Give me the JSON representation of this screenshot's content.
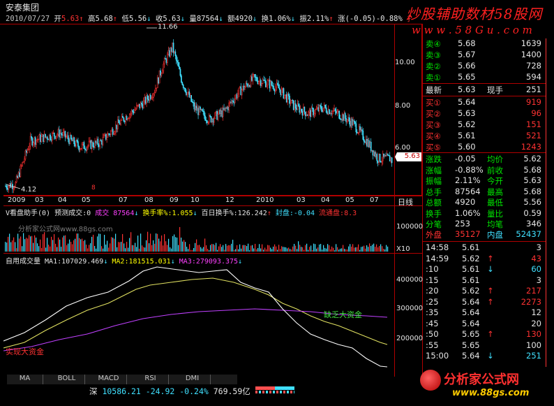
{
  "header": {
    "stock_name": "安泰集团",
    "date": "2010/07/27",
    "open_label": "开",
    "open": "5.63",
    "high_label": "高",
    "high": "5.68",
    "low_label": "低",
    "low": "5.56",
    "close_label": "收",
    "close": "5.63",
    "volume_label": "量",
    "volume": "87564",
    "amount_label": "额",
    "amount": "4920",
    "turnover_label": "换",
    "turnover": "1.06%",
    "amplitude_label": "振",
    "amplitude": "2.11%",
    "change_label": "涨",
    "change": "(-0.05)-0.88%",
    "truncated": "扌"
  },
  "watermark_top": {
    "line1": "炒股辅助数材58股网",
    "line2": "w w w . 5 8 G u . c o m"
  },
  "kline": {
    "price_axis": [
      "10.00",
      "8.00",
      "6.00"
    ],
    "current_price_tag": "5.63",
    "high_marker": "11.66",
    "low_marker": "4.12",
    "date_axis": [
      "2009",
      "03",
      "04",
      "05",
      "07",
      "08",
      "09",
      "10",
      "12",
      "2010",
      "03",
      "04",
      "05",
      "07"
    ],
    "small_marker": "8",
    "period_label": "日线",
    "ylim": [
      3.8,
      12.6
    ],
    "xlim": [
      0,
      380
    ]
  },
  "vol_panel": {
    "title": "V看盘助手(0)",
    "pred_label": "预测成交:0",
    "chengjiao_label": "成交",
    "chengjiao_value": "87564",
    "huanshou_label": "换手率%",
    "huanshou_value": ":1.055",
    "bairi_label": "百日换手%",
    "bairi_value": ":126.242",
    "extra1": "封盘:-0.04",
    "extra2": "流通盘",
    "extra2_value": ":8.3",
    "watermark": "分析家公式网www.88gs.com",
    "axis_top": "100000",
    "axis_unit": "X10"
  },
  "ma_panel": {
    "title": "自用成交量",
    "ma1_label": "MA1",
    "ma1": ":107029.469",
    "ma2_label": "MA2",
    "ma2": ":181515.031",
    "ma3_label": "MA3",
    "ma3": ":279093.375",
    "axis": [
      "400000",
      "300000",
      "200000"
    ],
    "annotation_lack": "缺乏大资金",
    "annotation_big": "实现大资金"
  },
  "tabs": [
    "MA",
    "BOLL",
    "MACD",
    "RSI",
    "DMI"
  ],
  "status_bar": {
    "index_name": "深",
    "index_value": "10586.21",
    "index_change": "-24.92",
    "index_pct": "-0.24%",
    "index_amount": "769.59亿"
  },
  "quote": {
    "sell": [
      {
        "label": "卖④",
        "price": "5.68",
        "vol": "1639"
      },
      {
        "label": "卖③",
        "price": "5.67",
        "vol": "1400"
      },
      {
        "label": "卖②",
        "price": "5.66",
        "vol": "728"
      },
      {
        "label": "卖①",
        "price": "5.65",
        "vol": "594"
      }
    ],
    "latest": {
      "label": "最新",
      "price": "5.63",
      "label2": "现手",
      "value2": "251"
    },
    "buy": [
      {
        "label": "买①",
        "price": "5.64",
        "vol": "919"
      },
      {
        "label": "买②",
        "price": "5.63",
        "vol": "96"
      },
      {
        "label": "买③",
        "price": "5.62",
        "vol": "151"
      },
      {
        "label": "买④",
        "price": "5.61",
        "vol": "521"
      },
      {
        "label": "买⑤",
        "price": "5.60",
        "vol": "1243"
      }
    ],
    "stats": [
      {
        "l1": "涨跌",
        "v1": "-0.05",
        "l2": "均价",
        "v2": "5.62"
      },
      {
        "l1": "涨幅",
        "v1": "-0.88%",
        "l2": "前收",
        "v2": "5.68"
      },
      {
        "l1": "振幅",
        "v1": "2.11%",
        "l2": "今开",
        "v2": "5.63"
      },
      {
        "l1": "总手",
        "v1": "87564",
        "l2": "最高",
        "v2": "5.68"
      },
      {
        "l1": "总额",
        "v1": "4920",
        "l2": "最低",
        "v2": "5.56"
      },
      {
        "l1": "换手",
        "v1": "1.06%",
        "l2": "量比",
        "v2": "0.59"
      },
      {
        "l1": "分笔",
        "v1": "253",
        "l2": "均笔",
        "v2": "346"
      }
    ],
    "outer_label": "外盘",
    "outer": "35127",
    "inner_label": "内盘",
    "inner": "52437"
  },
  "ticks": [
    {
      "t": "14:58",
      "p": "5.61",
      "a": "",
      "v": "3"
    },
    {
      "t": "14:59",
      "p": "5.62",
      "a": "↑",
      "v": "43"
    },
    {
      "t": ":10",
      "p": "5.61",
      "a": "↓",
      "v": "60"
    },
    {
      "t": ":15",
      "p": "5.61",
      "a": "",
      "v": "3"
    },
    {
      "t": ":20",
      "p": "5.62",
      "a": "↑",
      "v": "217"
    },
    {
      "t": ":25",
      "p": "5.64",
      "a": "↑",
      "v": "2273"
    },
    {
      "t": ":35",
      "p": "5.64",
      "a": "",
      "v": "12"
    },
    {
      "t": ":45",
      "p": "5.64",
      "a": "",
      "v": "20"
    },
    {
      "t": ":50",
      "p": "5.65",
      "a": "↑",
      "v": "130"
    },
    {
      "t": ":55",
      "p": "5.65",
      "a": "",
      "v": "100"
    },
    {
      "t": "15:00",
      "p": "5.64",
      "a": "↓",
      "v": "251"
    }
  ],
  "bottom_logo": {
    "line1": "分析家公式网",
    "line2": "www.88gs.com"
  },
  "colors": {
    "up": "#ff3232",
    "down": "#00ffff",
    "frame": "#b00000"
  }
}
